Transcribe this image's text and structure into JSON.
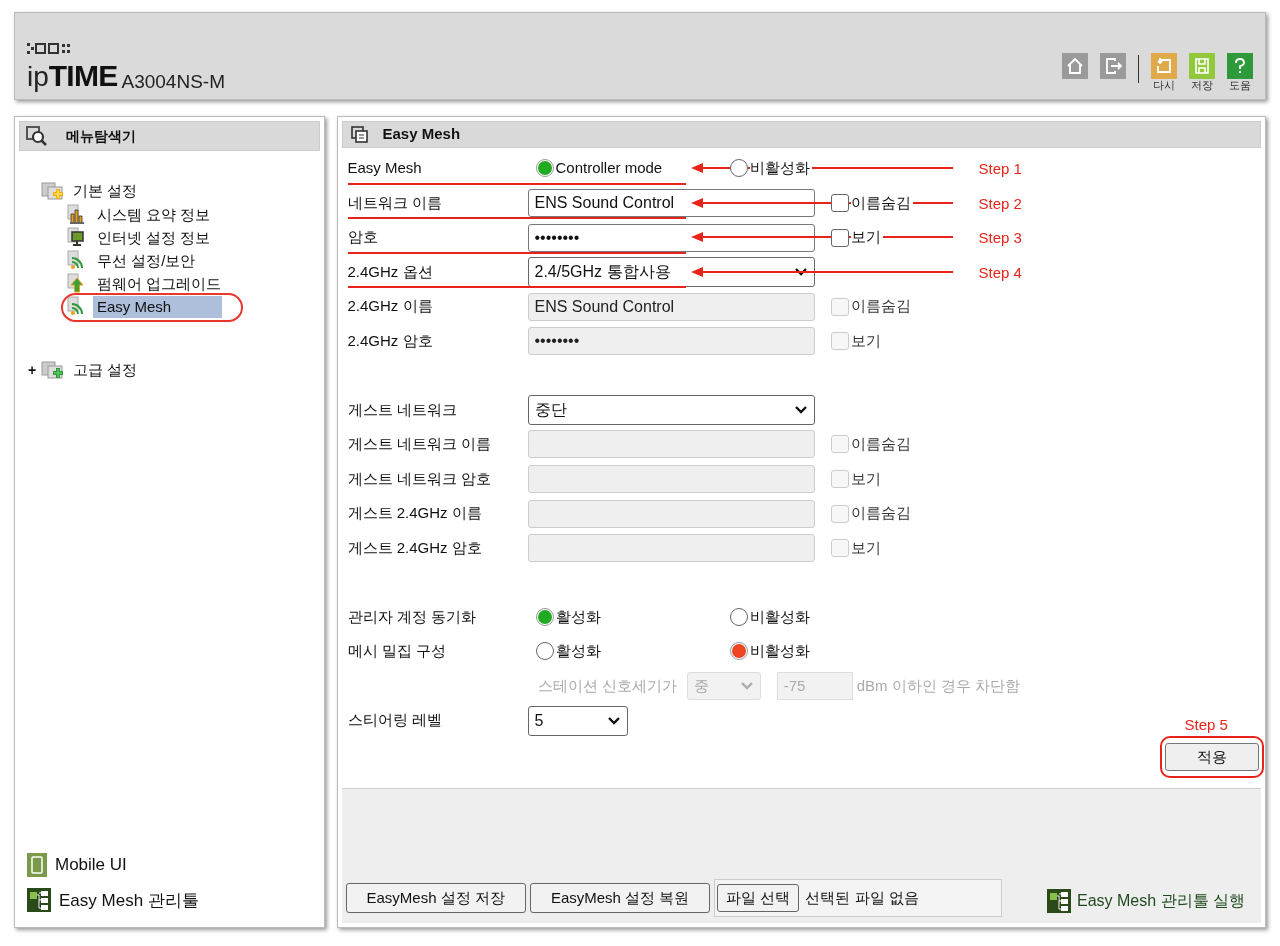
{
  "header": {
    "logo_prefix": "ip",
    "logo_mark": "TIME",
    "model": "A3004NS-M",
    "toolbar": [
      {
        "kind": "home"
      },
      {
        "kind": "logout"
      },
      {
        "kind": "reset",
        "label": "다시"
      },
      {
        "kind": "save",
        "label": "저장"
      },
      {
        "kind": "help",
        "label": "도움"
      }
    ]
  },
  "sidebar": {
    "title": "메뉴탐색기",
    "tree": [
      {
        "label": "기본 설정",
        "expanded": true,
        "children": [
          {
            "label": "시스템 요약 정보",
            "kind": "chart",
            "selected": false,
            "circled": false
          },
          {
            "label": "인터넷 설정 정보",
            "kind": "monitor",
            "selected": false,
            "circled": false
          },
          {
            "label": "무선 설정/보안",
            "kind": "wireless",
            "selected": false,
            "circled": false
          },
          {
            "label": "펌웨어 업그레이드",
            "kind": "upgrade",
            "selected": false,
            "circled": false
          },
          {
            "label": "Easy Mesh",
            "kind": "wireless",
            "selected": true,
            "circled": true
          }
        ]
      },
      {
        "label": "고급 설정",
        "expanded": false,
        "expander": "+"
      }
    ],
    "links": [
      {
        "kind": "mobile",
        "label": "Mobile UI"
      },
      {
        "kind": "mesh",
        "label": "Easy Mesh 관리툴"
      }
    ]
  },
  "main": {
    "title": "Easy Mesh",
    "groups": [
      [
        {
          "kind": "radio",
          "label": "Easy Mesh",
          "step": "Step 1",
          "options": [
            {
              "label": "Controller mode",
              "selected": true,
              "color": "#22aa22"
            },
            {
              "label": "비활성화",
              "selected": false
            }
          ]
        },
        {
          "kind": "text",
          "label": "네트워크 이름",
          "step": "Step 2",
          "value": "ENS Sound Control",
          "disabled": false,
          "checkbox": {
            "label": "이름숨김",
            "checked": false,
            "disabled": false
          }
        },
        {
          "kind": "text",
          "label": "암호",
          "step": "Step 3",
          "value": "••••••••",
          "disabled": false,
          "checkbox": {
            "label": "보기",
            "checked": false,
            "disabled": false
          }
        },
        {
          "kind": "select",
          "label": "2.4GHz 옵션",
          "step": "Step 4",
          "value": "2.4/5GHz 통합사용",
          "disabled": false
        },
        {
          "kind": "text",
          "label": "2.4GHz 이름",
          "value": "ENS Sound Control",
          "disabled": true,
          "checkbox": {
            "label": "이름숨김",
            "checked": false,
            "disabled": true
          }
        },
        {
          "kind": "text",
          "label": "2.4GHz 암호",
          "value": "••••••••",
          "disabled": true,
          "checkbox": {
            "label": "보기",
            "checked": false,
            "disabled": true
          }
        }
      ],
      [
        {
          "kind": "select",
          "label": "게스트 네트워크",
          "value": "중단",
          "disabled": false
        },
        {
          "kind": "text",
          "label": "게스트 네트워크 이름",
          "disabled": true,
          "checkbox": {
            "label": "이름숨김",
            "checked": false,
            "disabled": true
          }
        },
        {
          "kind": "text",
          "label": "게스트 네트워크 암호",
          "disabled": true,
          "checkbox": {
            "label": "보기",
            "checked": false,
            "disabled": true
          }
        },
        {
          "kind": "text",
          "label": "게스트 2.4GHz 이름",
          "disabled": true,
          "checkbox": {
            "label": "이름숨김",
            "checked": false,
            "disabled": true
          }
        },
        {
          "kind": "text",
          "label": "게스트 2.4GHz 암호",
          "disabled": true,
          "checkbox": {
            "label": "보기",
            "checked": false,
            "disabled": true
          }
        }
      ],
      [
        {
          "kind": "radio",
          "label": "관리자 계정 동기화",
          "options": [
            {
              "label": "활성화",
              "selected": true,
              "color": "#22aa22"
            },
            {
              "label": "비활성화",
              "selected": false
            }
          ]
        },
        {
          "kind": "radio",
          "label": "메시 밀집 구성",
          "options": [
            {
              "label": "활성화",
              "selected": false
            },
            {
              "label": "비활성화",
              "selected": true,
              "color": "#ee4422"
            }
          ]
        },
        {
          "kind": "signal",
          "prefix": "스테이션 신호세기가",
          "level_select": "중",
          "threshold": "-75",
          "suffix": "dBm 이하인 경우 차단함",
          "disabled": true
        },
        {
          "kind": "select",
          "label": "스티어링 레벨",
          "value": "5",
          "disabled": false,
          "small": true
        }
      ]
    ],
    "apply": {
      "label": "적용",
      "step": "Step 5",
      "circled": true
    }
  },
  "footer": {
    "buttons": [
      "EasyMesh 설정 저장",
      "EasyMesh 설정 복원"
    ],
    "file": {
      "button": "파일 선택",
      "status": "선택된 파일 없음"
    },
    "link": "Easy Mesh 관리툴 실행"
  }
}
